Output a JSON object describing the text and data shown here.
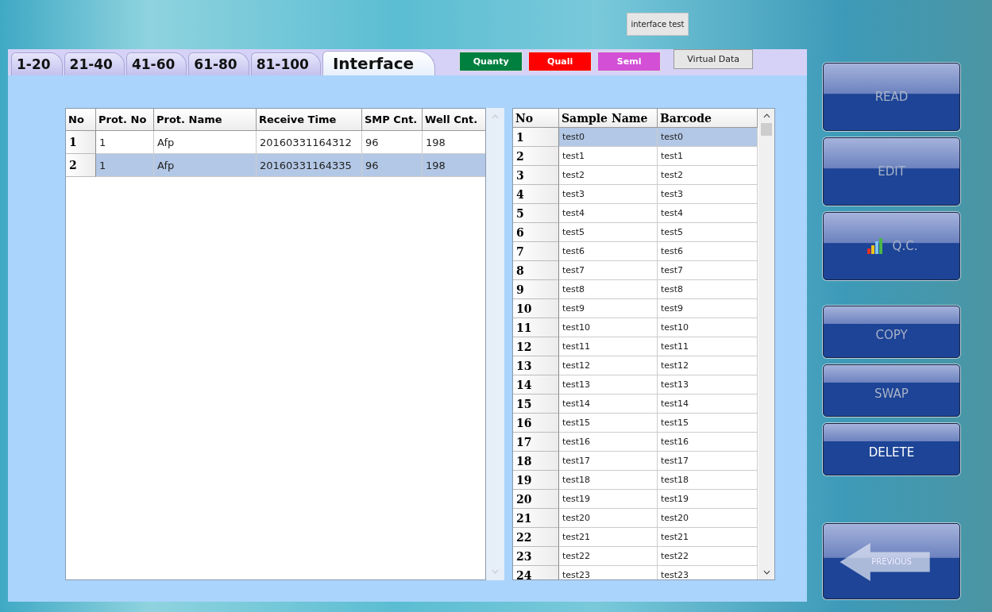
{
  "top_button": {
    "label": "interface test"
  },
  "tabs": [
    {
      "label": "1-20",
      "selected": false
    },
    {
      "label": "21-40",
      "selected": false
    },
    {
      "label": "41-60",
      "selected": false
    },
    {
      "label": "61-80",
      "selected": false
    },
    {
      "label": "81-100",
      "selected": false
    },
    {
      "label": "Interface",
      "selected": true
    }
  ],
  "mode_buttons": [
    {
      "label": "Quanty",
      "color": "#00803f"
    },
    {
      "label": "Quali",
      "color": "#ff0000"
    },
    {
      "label": "Semi",
      "color": "#d24fd6"
    }
  ],
  "virtual_button": {
    "label": "Virtual Data"
  },
  "protocol_table": {
    "columns": [
      "No",
      "Prot. No",
      "Prot.  Name",
      "Receive Time",
      "SMP Cnt.",
      "Well Cnt."
    ],
    "rows": [
      {
        "cells": [
          "1",
          "1",
          "Afp",
          "20160331164312",
          "96",
          "198"
        ],
        "selected": false
      },
      {
        "cells": [
          "2",
          "1",
          "Afp",
          "20160331164335",
          "96",
          "198"
        ],
        "selected": true
      }
    ]
  },
  "sample_table": {
    "columns": [
      "No",
      "Sample Name",
      "Barcode"
    ],
    "rows": [
      {
        "cells": [
          "1",
          "test0",
          "test0"
        ],
        "selected": true
      },
      {
        "cells": [
          "2",
          "test1",
          "test1"
        ],
        "selected": false
      },
      {
        "cells": [
          "3",
          "test2",
          "test2"
        ],
        "selected": false
      },
      {
        "cells": [
          "4",
          "test3",
          "test3"
        ],
        "selected": false
      },
      {
        "cells": [
          "5",
          "test4",
          "test4"
        ],
        "selected": false
      },
      {
        "cells": [
          "6",
          "test5",
          "test5"
        ],
        "selected": false
      },
      {
        "cells": [
          "7",
          "test6",
          "test6"
        ],
        "selected": false
      },
      {
        "cells": [
          "8",
          "test7",
          "test7"
        ],
        "selected": false
      },
      {
        "cells": [
          "9",
          "test8",
          "test8"
        ],
        "selected": false
      },
      {
        "cells": [
          "10",
          "test9",
          "test9"
        ],
        "selected": false
      },
      {
        "cells": [
          "11",
          "test10",
          "test10"
        ],
        "selected": false
      },
      {
        "cells": [
          "12",
          "test11",
          "test11"
        ],
        "selected": false
      },
      {
        "cells": [
          "13",
          "test12",
          "test12"
        ],
        "selected": false
      },
      {
        "cells": [
          "14",
          "test13",
          "test13"
        ],
        "selected": false
      },
      {
        "cells": [
          "15",
          "test14",
          "test14"
        ],
        "selected": false
      },
      {
        "cells": [
          "16",
          "test15",
          "test15"
        ],
        "selected": false
      },
      {
        "cells": [
          "17",
          "test16",
          "test16"
        ],
        "selected": false
      },
      {
        "cells": [
          "18",
          "test17",
          "test17"
        ],
        "selected": false
      },
      {
        "cells": [
          "19",
          "test18",
          "test18"
        ],
        "selected": false
      },
      {
        "cells": [
          "20",
          "test19",
          "test19"
        ],
        "selected": false
      },
      {
        "cells": [
          "21",
          "test20",
          "test20"
        ],
        "selected": false
      },
      {
        "cells": [
          "22",
          "test21",
          "test21"
        ],
        "selected": false
      },
      {
        "cells": [
          "23",
          "test22",
          "test22"
        ],
        "selected": false
      },
      {
        "cells": [
          "24",
          "test23",
          "test23"
        ],
        "selected": false
      }
    ]
  },
  "side_buttons": [
    [
      {
        "label": "READ",
        "kind": "text",
        "disabled": true
      },
      {
        "label": "EDIT",
        "kind": "text",
        "disabled": true
      },
      {
        "label": "Q.C.",
        "kind": "chart",
        "disabled": true
      }
    ],
    [
      {
        "label": "COPY",
        "kind": "text",
        "disabled": true
      },
      {
        "label": "SWAP",
        "kind": "text",
        "disabled": true
      },
      {
        "label": "DELETE",
        "kind": "text",
        "disabled": false
      }
    ],
    [
      {
        "label": "PREVIOUS",
        "kind": "arrow",
        "disabled": false
      }
    ]
  ]
}
